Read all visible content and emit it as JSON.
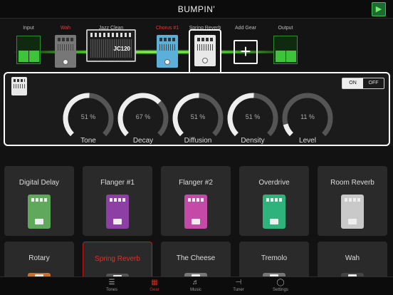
{
  "app": {
    "title": "BUMPIN'",
    "signal_icon": "speaker-icon"
  },
  "chain": {
    "nodes": [
      {
        "label": "Input",
        "type": "jack"
      },
      {
        "label": "Wah",
        "type": "pedal",
        "red": true
      },
      {
        "label": "Jazz Clean",
        "type": "amp",
        "amp_name": "JC120"
      },
      {
        "label": "Chorus #1",
        "type": "pedal",
        "red": true
      },
      {
        "label": "Spring Reverb",
        "type": "pedal",
        "selected": true
      },
      {
        "label": "Add Gear",
        "type": "add"
      },
      {
        "label": "Output",
        "type": "jack"
      }
    ]
  },
  "panel": {
    "toggle": {
      "on": "ON",
      "off": "OFF",
      "state": "ON"
    },
    "knobs": [
      {
        "name": "Tone",
        "value_text": "51 %",
        "value": 0.51
      },
      {
        "name": "Decay",
        "value_text": "67 %",
        "value": 0.67
      },
      {
        "name": "Diffusion",
        "value_text": "51 %",
        "value": 0.51
      },
      {
        "name": "Density",
        "value_text": "51 %",
        "value": 0.51
      },
      {
        "name": "Level",
        "value_text": "11 %",
        "value": 0.11
      }
    ]
  },
  "tiles": [
    {
      "name": "Digital Delay",
      "color": "#5fa85c"
    },
    {
      "name": "Flanger #1",
      "color": "#8e3fa6"
    },
    {
      "name": "Flanger #2",
      "color": "#c54aa8"
    },
    {
      "name": "Overdrive",
      "color": "#2fb37c"
    },
    {
      "name": "Room Reverb",
      "color": "#c9c9c9"
    },
    {
      "name": "Rotary",
      "color": "#c97030"
    },
    {
      "name": "Spring Reverb",
      "color": "#555555",
      "selected": true
    },
    {
      "name": "The Cheese",
      "color": "#777777"
    },
    {
      "name": "Tremolo",
      "color": "#777777"
    },
    {
      "name": "Wah",
      "color": "#444444"
    }
  ],
  "tabs": [
    {
      "label": "Tones",
      "icon": "list-icon"
    },
    {
      "label": "Gear",
      "icon": "amp-icon",
      "active": true
    },
    {
      "label": "Music",
      "icon": "music-icon"
    },
    {
      "label": "Tuner",
      "icon": "tuner-icon"
    },
    {
      "label": "Settings",
      "icon": "gamepad-icon"
    }
  ],
  "colors": {
    "accent": "#d6281d",
    "signal": "#49d12c"
  }
}
